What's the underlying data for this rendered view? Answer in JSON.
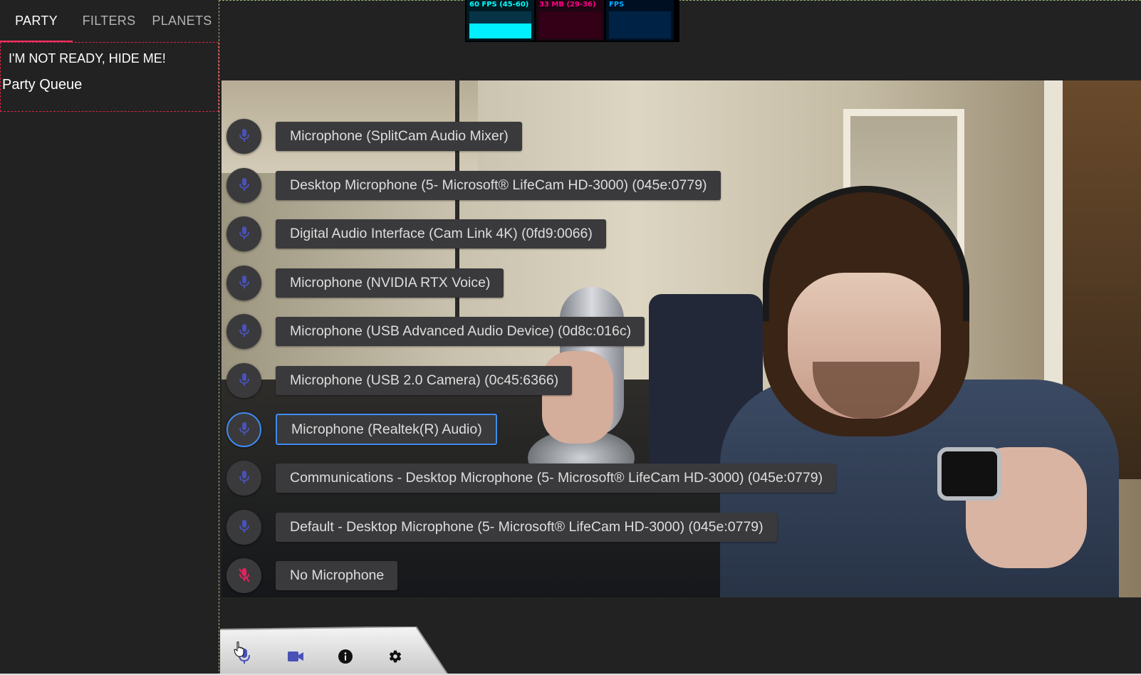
{
  "sidebar": {
    "tabs": [
      {
        "label": "PARTY",
        "active": true
      },
      {
        "label": "FILTERS",
        "active": false
      },
      {
        "label": "PLANETS",
        "active": false
      }
    ],
    "not_ready_label": "I'M NOT READY, HIDE ME!",
    "party_queue_label": "Party Queue"
  },
  "perf_monitor": {
    "fps_label": "60 FPS (45-60)",
    "fps_level": 0.55,
    "memory_label": "33 MB (29-36)",
    "third_label": "FPS"
  },
  "devices": [
    {
      "label": "Microphone (SplitCam Audio Mixer)",
      "icon": "microphone-icon",
      "selected": false
    },
    {
      "label": "Desktop Microphone (5- Microsoft® LifeCam HD-3000) (045e:0779)",
      "icon": "microphone-icon",
      "selected": false
    },
    {
      "label": "Digital Audio Interface (Cam Link 4K) (0fd9:0066)",
      "icon": "microphone-icon",
      "selected": false
    },
    {
      "label": "Microphone (NVIDIA RTX Voice)",
      "icon": "microphone-icon",
      "selected": false
    },
    {
      "label": "Microphone (USB Advanced Audio Device) (0d8c:016c)",
      "icon": "microphone-icon",
      "selected": false
    },
    {
      "label": "Microphone (USB 2.0 Camera) (0c45:6366)",
      "icon": "microphone-icon",
      "selected": false
    },
    {
      "label": "Microphone (Realtek(R) Audio)",
      "icon": "microphone-icon",
      "selected": true
    },
    {
      "label": "Communications - Desktop Microphone (5- Microsoft® LifeCam HD-3000) (045e:0779)",
      "icon": "microphone-icon",
      "selected": false
    },
    {
      "label": "Default - Desktop Microphone (5- Microsoft® LifeCam HD-3000) (045e:0779)",
      "icon": "microphone-icon",
      "selected": false
    },
    {
      "label": "No Microphone",
      "icon": "microphone-off-icon",
      "selected": false
    }
  ],
  "toolbar": {
    "buttons": [
      "microphone-icon",
      "video-camera-icon",
      "info-icon",
      "gear-icon"
    ]
  },
  "colors": {
    "accent": "#3f8cf0",
    "mic_icon": "#4a52b8",
    "mic_off_icon": "#e0245e",
    "tab_underline": "#ff3060"
  }
}
